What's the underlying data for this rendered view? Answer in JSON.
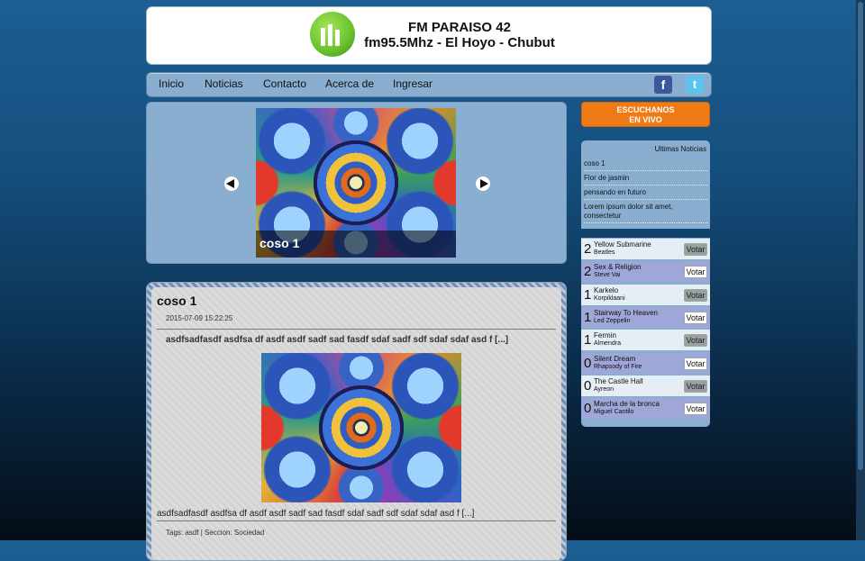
{
  "header": {
    "title": "FM PARAISO 42",
    "subtitle": "fm95.5Mhz - El Hoyo - Chubut",
    "logo_icon": "radio-bars-logo"
  },
  "nav": {
    "items": [
      "Inicio",
      "Noticias",
      "Contacto",
      "Acerca de",
      "Ingresar"
    ],
    "facebook_glyph": "f",
    "twitter_glyph": "t"
  },
  "slider": {
    "caption": "coso 1"
  },
  "article": {
    "title": "coso 1",
    "date": "2015-07-09 15:22:25",
    "excerpt": "asdfsadfasdf asdfsa df asdf asdf sadf sad fasdf sdaf sadf sdf sdaf sdaf asd f [...]",
    "body": "asdfsadfasdf asdfsa df asdf asdf sadf sad fasdf sdaf sadf sdf sdaf sdaf asd f [...]",
    "tags_label": "Tags:",
    "tag": "asdf",
    "separator": " | Seccion: ",
    "section": "Sociedad"
  },
  "live_button": {
    "line1": "ESCUCHANOS",
    "line2": "EN VIVO"
  },
  "news": {
    "heading": "Ultimas Noticias",
    "items": [
      "coso 1",
      "Flor de jasmin",
      "pensando en futuro",
      "Lorem ipsum dolor sit amet,",
      "consectetur"
    ]
  },
  "ranking": {
    "vote_label": "Votar",
    "items": [
      {
        "votes": "2",
        "song": "Yellow Submarine",
        "artist": "Beatles"
      },
      {
        "votes": "2",
        "song": "Sex & Religion",
        "artist": "Steve Vai"
      },
      {
        "votes": "1",
        "song": "Karkelo",
        "artist": "Korpiklaani"
      },
      {
        "votes": "1",
        "song": "Stairway To Heaven",
        "artist": "Led Zeppelin"
      },
      {
        "votes": "1",
        "song": "Fermin",
        "artist": "Almendra"
      },
      {
        "votes": "0",
        "song": "Silent Dream",
        "artist": "Rhapsody of Fire"
      },
      {
        "votes": "0",
        "song": "The Castle Hall",
        "artist": "Ayreon"
      },
      {
        "votes": "0",
        "song": "Marcha de la bronca",
        "artist": "Miguel Cantilo"
      }
    ]
  },
  "colors": {
    "accent": "#ef7a16",
    "panel": "#8aaed0",
    "ranking_alt": "#9fa6d8"
  }
}
